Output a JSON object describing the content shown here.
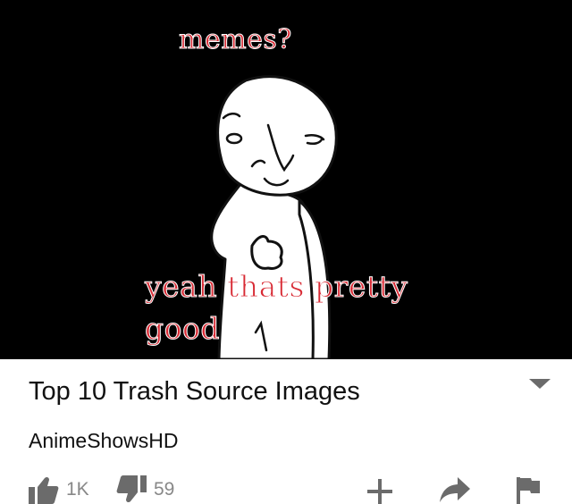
{
  "video": {
    "caption_top": "memes?",
    "caption_bottom_line1": "yeah thats pretty",
    "caption_bottom_line2": "good"
  },
  "title": "Top 10  Trash Source Images",
  "channel": "AnimeShowsHD",
  "actions": {
    "likes": "1K",
    "dislikes": "59"
  },
  "icons": [
    "thumbs-up-icon",
    "thumbs-down-icon",
    "add-to-playlist-icon",
    "share-icon",
    "flag-icon",
    "chevron-down-icon"
  ],
  "colors": {
    "caption": "#d82a34",
    "icon": "#6b6b6b",
    "count": "#888888"
  }
}
